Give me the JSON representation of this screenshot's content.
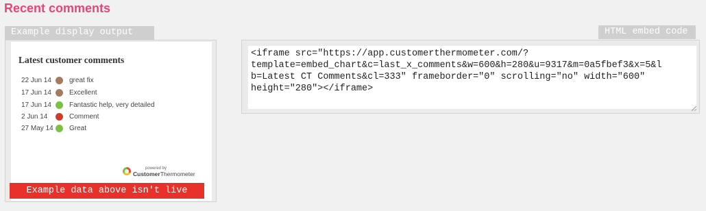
{
  "section_title": "Recent comments",
  "left_tab": "Example display output",
  "right_tab": "HTML embed code",
  "widget": {
    "title": "Latest customer comments",
    "comments": [
      {
        "date": "22 Jun 14",
        "color": "#a57b5e",
        "text": "great fix"
      },
      {
        "date": "17 Jun 14",
        "color": "#a57b5e",
        "text": "Excellent"
      },
      {
        "date": "17 Jun 14",
        "color": "#7ac143",
        "text": "Fantastic help, very detailed"
      },
      {
        "date": "2 Jun 14",
        "color": "#d33a2c",
        "text": "Comment"
      },
      {
        "date": "27 May 14",
        "color": "#7ac143",
        "text": "Great"
      }
    ],
    "powered_small": "powered by",
    "powered_brand_bold": "Customer",
    "powered_brand_rest": "Thermometer"
  },
  "notice": "Example data above isn't live",
  "embed_code": "<iframe src=\"https://app.customerthermometer.com/?\ntemplate=embed_chart&c=last_x_comments&w=600&h=280&u=9317&m=0a5fbef3&x=5&l\nb=Latest CT Comments&cl=333\" frameborder=\"0\" scrolling=\"no\" width=\"600\"\nheight=\"280\"></iframe>"
}
